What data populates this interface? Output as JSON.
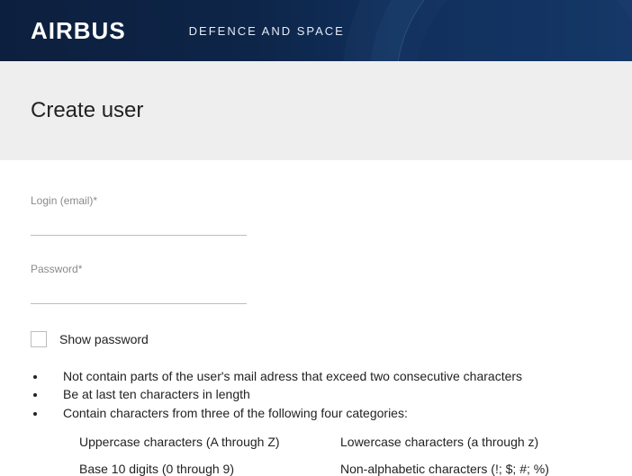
{
  "header": {
    "brand": "AIRBUS",
    "subBrand": "DEFENCE AND SPACE"
  },
  "page": {
    "title": "Create user"
  },
  "form": {
    "loginLabel": "Login (email)*",
    "passwordLabel": "Password*",
    "showPasswordLabel": "Show password"
  },
  "rules": {
    "r1": "Not contain parts of the user's mail adress that exceed two consecutive characters",
    "r2": "Be at last ten characters in length",
    "r3": "Contain characters from three of the following four categories:"
  },
  "categories": {
    "c1": "Uppercase characters (A through Z)",
    "c2": "Lowercase characters (a through z)",
    "c3": "Base 10 digits (0 through 9)",
    "c4": "Non-alphabetic characters (!; $; #; %)"
  }
}
